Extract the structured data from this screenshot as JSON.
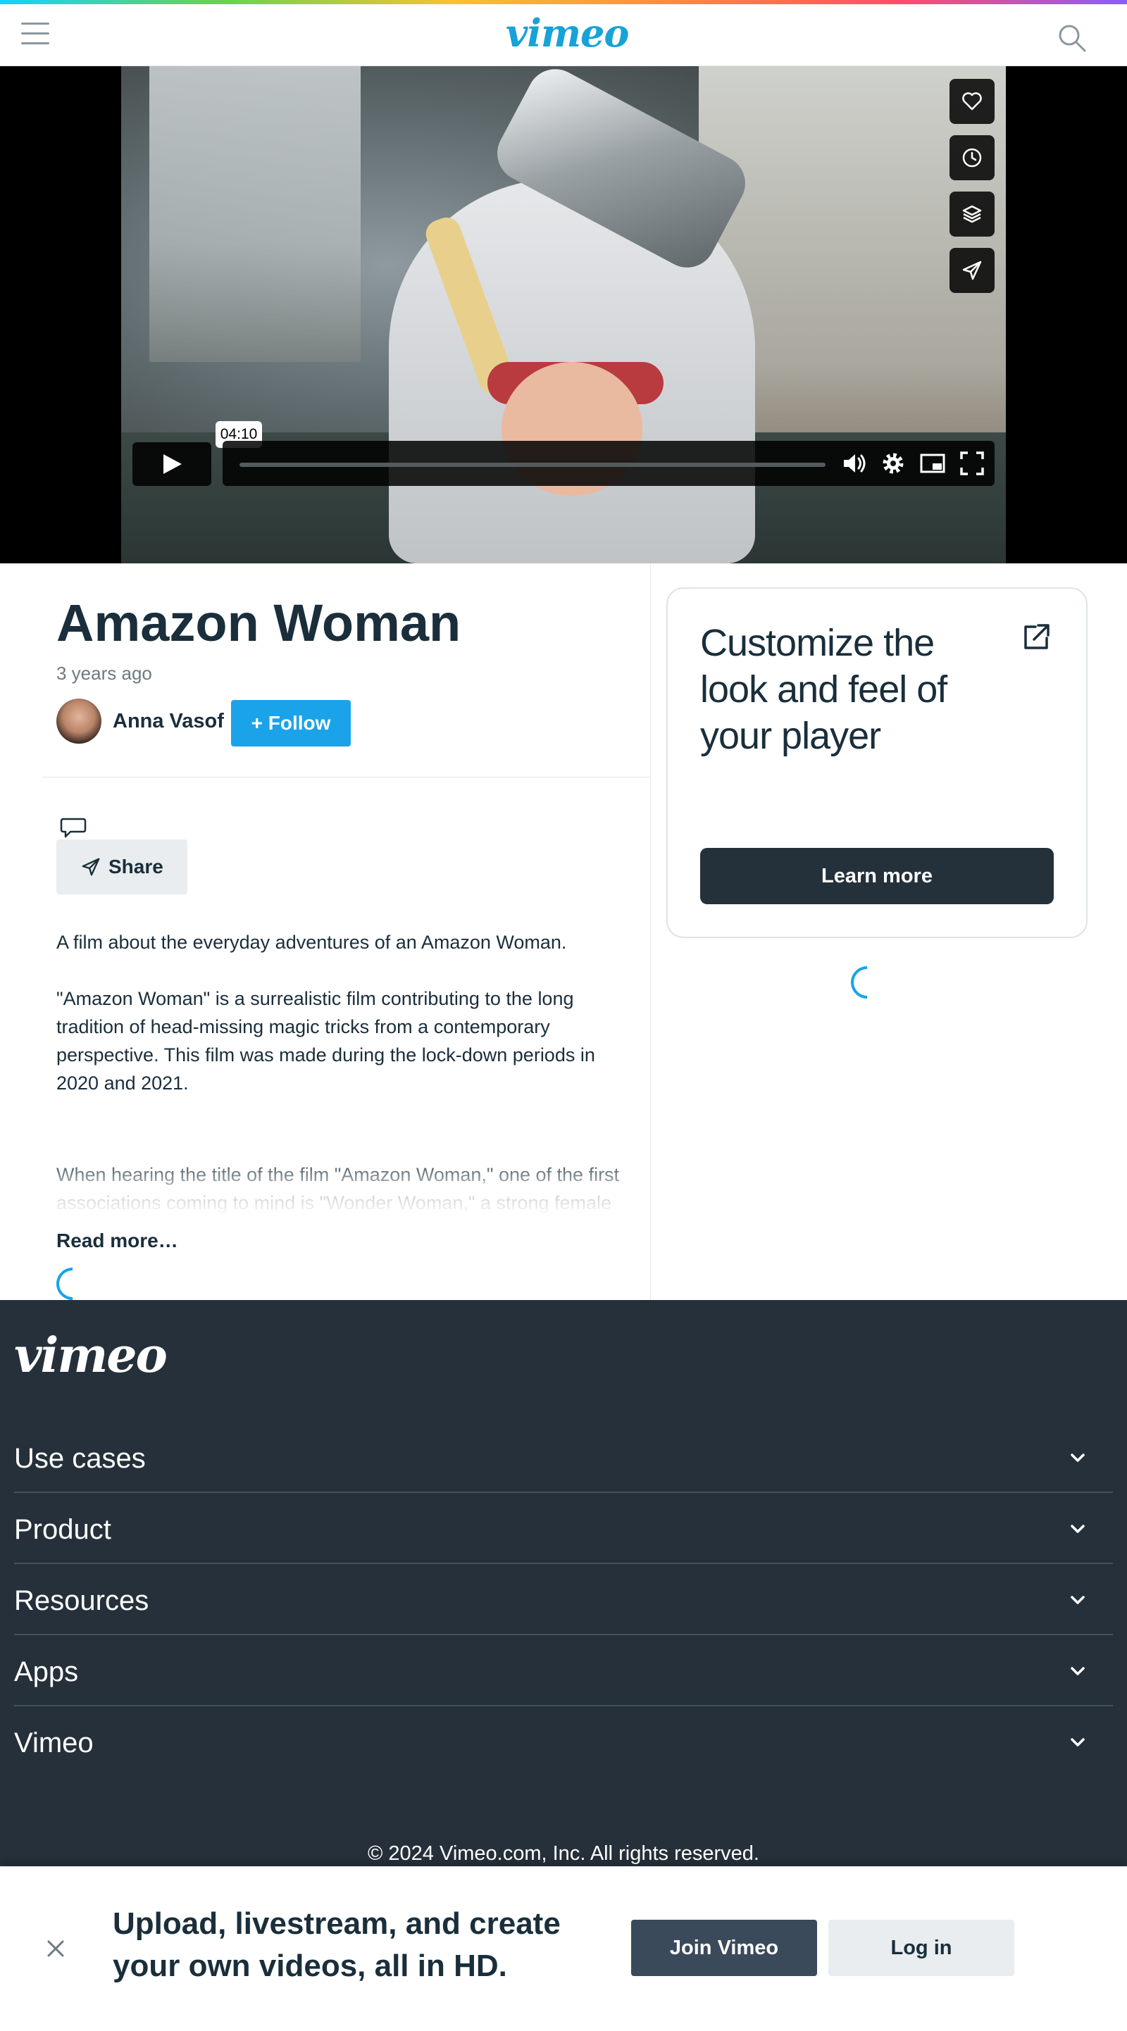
{
  "header": {
    "logo": "vimeo",
    "menu_icon": "hamburger-menu-icon",
    "search_icon": "search-icon"
  },
  "player": {
    "side_actions": [
      "heart-icon",
      "clock-icon",
      "layers-icon",
      "send-icon"
    ],
    "timestamp": "04:10",
    "controls": [
      "play-icon",
      "volume-icon",
      "settings-icon",
      "picture-in-picture-icon",
      "fullscreen-icon"
    ]
  },
  "video": {
    "title": "Amazon Woman",
    "posted": "3 years ago",
    "author": "Anna Vasof",
    "follow_label": "+ Follow",
    "share_label": "Share"
  },
  "description": {
    "line1": "A film about the everyday adventures of an Amazon Woman.",
    "para2": "\"Amazon Woman\" is a surrealistic film contributing to the long tradition of head-missing magic tricks from a contemporary perspective. This film was made during the lock-down periods in 2020 and 2021.",
    "para3": "When hearing the title of the film \"Amazon Woman,\" one of the first associations coming to mind is \"Wonder Woman,\" a strong female character fighting for justice and realizing her dreams. In pandemic times, however, \"Amazon Woman\" stands mainly for a lonely person constantly ordering things from Amazon.com",
    "read_more": "Read more…"
  },
  "promo": {
    "title": "Customize the look and feel of your player",
    "button": "Learn more"
  },
  "footer": {
    "logo": "vimeo",
    "sections": [
      "Use cases",
      "Product",
      "Resources",
      "Apps",
      "Vimeo"
    ],
    "copyright": "© 2024 Vimeo.com, Inc. All rights reserved."
  },
  "banner": {
    "text": "Upload, livestream, and create your own videos, all in HD.",
    "join_label": "Join Vimeo",
    "login_label": "Log in"
  },
  "colors": {
    "accent": "#1aa3e8",
    "dark": "#25303a",
    "text": "#1a2e3b"
  }
}
